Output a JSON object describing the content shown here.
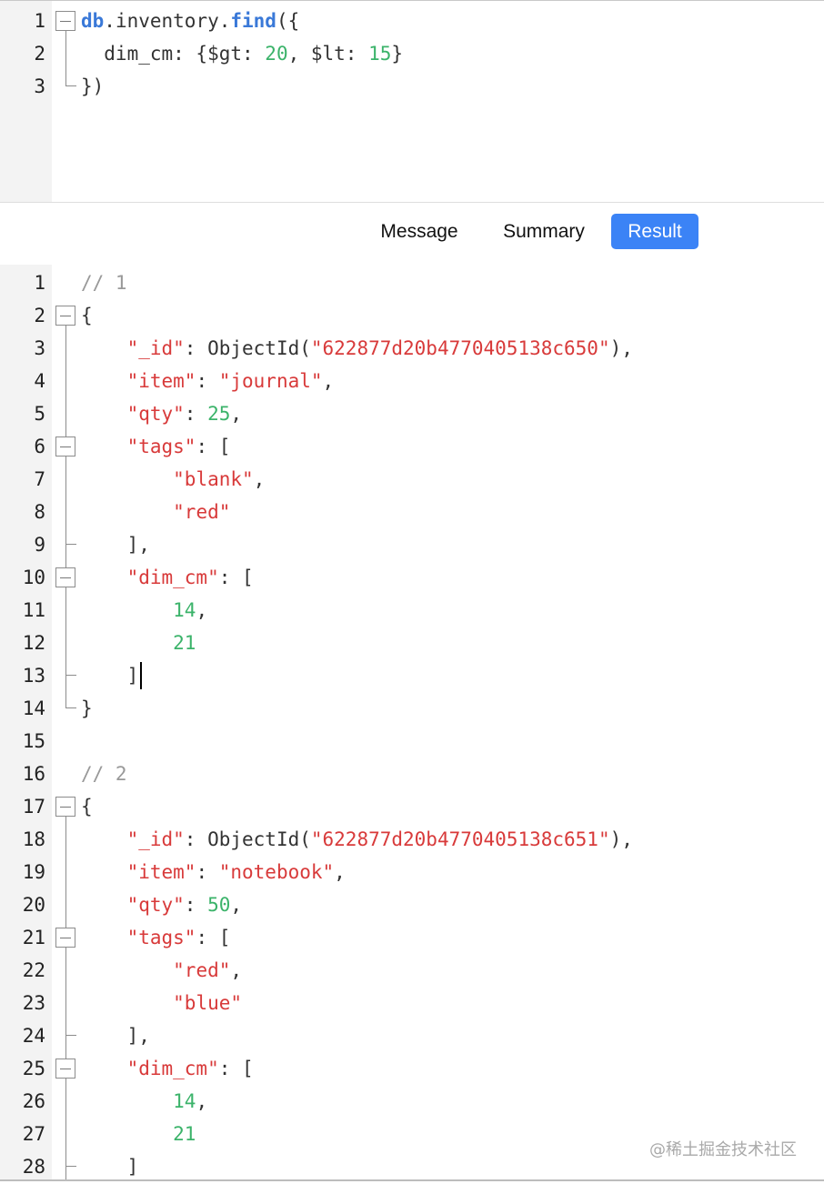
{
  "query": {
    "lines": [
      {
        "num": "1",
        "tokens": [
          [
            "kw",
            "db"
          ],
          [
            "pl",
            ".inventory."
          ],
          [
            "kw",
            "find"
          ],
          [
            "pl",
            "({"
          ]
        ]
      },
      {
        "num": "2",
        "tokens": [
          [
            "pl",
            "  dim_cm: {$gt: "
          ],
          [
            "num",
            "20"
          ],
          [
            "pl",
            ", $lt: "
          ],
          [
            "num",
            "15"
          ],
          [
            "pl",
            "}"
          ]
        ]
      },
      {
        "num": "3",
        "tokens": [
          [
            "pl",
            "})"
          ]
        ]
      }
    ]
  },
  "tabs": [
    {
      "label": "Message",
      "active": false
    },
    {
      "label": "Summary",
      "active": false
    },
    {
      "label": "Result",
      "active": true
    }
  ],
  "result": {
    "lines": [
      {
        "num": "1",
        "tokens": [
          [
            "com",
            "// 1"
          ]
        ]
      },
      {
        "num": "2",
        "tokens": [
          [
            "pl",
            "{"
          ]
        ]
      },
      {
        "num": "3",
        "tokens": [
          [
            "pl",
            "    "
          ],
          [
            "key",
            "\"_id\""
          ],
          [
            "pl",
            ": ObjectId("
          ],
          [
            "str",
            "\"622877d20b4770405138c650\""
          ],
          [
            "pl",
            "),"
          ]
        ]
      },
      {
        "num": "4",
        "tokens": [
          [
            "pl",
            "    "
          ],
          [
            "key",
            "\"item\""
          ],
          [
            "pl",
            ": "
          ],
          [
            "str",
            "\"journal\""
          ],
          [
            "pl",
            ","
          ]
        ]
      },
      {
        "num": "5",
        "tokens": [
          [
            "pl",
            "    "
          ],
          [
            "key",
            "\"qty\""
          ],
          [
            "pl",
            ": "
          ],
          [
            "num",
            "25"
          ],
          [
            "pl",
            ","
          ]
        ]
      },
      {
        "num": "6",
        "tokens": [
          [
            "pl",
            "    "
          ],
          [
            "key",
            "\"tags\""
          ],
          [
            "pl",
            ": ["
          ]
        ]
      },
      {
        "num": "7",
        "tokens": [
          [
            "pl",
            "        "
          ],
          [
            "str",
            "\"blank\""
          ],
          [
            "pl",
            ","
          ]
        ]
      },
      {
        "num": "8",
        "tokens": [
          [
            "pl",
            "        "
          ],
          [
            "str",
            "\"red\""
          ]
        ]
      },
      {
        "num": "9",
        "tokens": [
          [
            "pl",
            "    ],"
          ]
        ]
      },
      {
        "num": "10",
        "tokens": [
          [
            "pl",
            "    "
          ],
          [
            "key",
            "\"dim_cm\""
          ],
          [
            "pl",
            ": ["
          ]
        ]
      },
      {
        "num": "11",
        "tokens": [
          [
            "pl",
            "        "
          ],
          [
            "num",
            "14"
          ],
          [
            "pl",
            ","
          ]
        ]
      },
      {
        "num": "12",
        "tokens": [
          [
            "pl",
            "        "
          ],
          [
            "num",
            "21"
          ]
        ]
      },
      {
        "num": "13",
        "tokens": [
          [
            "pl",
            "    ]"
          ]
        ]
      },
      {
        "num": "14",
        "tokens": [
          [
            "pl",
            "}"
          ]
        ]
      },
      {
        "num": "15",
        "tokens": []
      },
      {
        "num": "16",
        "tokens": [
          [
            "com",
            "// 2"
          ]
        ]
      },
      {
        "num": "17",
        "tokens": [
          [
            "pl",
            "{"
          ]
        ]
      },
      {
        "num": "18",
        "tokens": [
          [
            "pl",
            "    "
          ],
          [
            "key",
            "\"_id\""
          ],
          [
            "pl",
            ": ObjectId("
          ],
          [
            "str",
            "\"622877d20b4770405138c651\""
          ],
          [
            "pl",
            "),"
          ]
        ]
      },
      {
        "num": "19",
        "tokens": [
          [
            "pl",
            "    "
          ],
          [
            "key",
            "\"item\""
          ],
          [
            "pl",
            ": "
          ],
          [
            "str",
            "\"notebook\""
          ],
          [
            "pl",
            ","
          ]
        ]
      },
      {
        "num": "20",
        "tokens": [
          [
            "pl",
            "    "
          ],
          [
            "key",
            "\"qty\""
          ],
          [
            "pl",
            ": "
          ],
          [
            "num",
            "50"
          ],
          [
            "pl",
            ","
          ]
        ]
      },
      {
        "num": "21",
        "tokens": [
          [
            "pl",
            "    "
          ],
          [
            "key",
            "\"tags\""
          ],
          [
            "pl",
            ": ["
          ]
        ]
      },
      {
        "num": "22",
        "tokens": [
          [
            "pl",
            "        "
          ],
          [
            "str",
            "\"red\""
          ],
          [
            "pl",
            ","
          ]
        ]
      },
      {
        "num": "23",
        "tokens": [
          [
            "pl",
            "        "
          ],
          [
            "str",
            "\"blue\""
          ]
        ]
      },
      {
        "num": "24",
        "tokens": [
          [
            "pl",
            "    ],"
          ]
        ]
      },
      {
        "num": "25",
        "tokens": [
          [
            "pl",
            "    "
          ],
          [
            "key",
            "\"dim_cm\""
          ],
          [
            "pl",
            ": ["
          ]
        ]
      },
      {
        "num": "26",
        "tokens": [
          [
            "pl",
            "        "
          ],
          [
            "num",
            "14"
          ],
          [
            "pl",
            ","
          ]
        ]
      },
      {
        "num": "27",
        "tokens": [
          [
            "pl",
            "        "
          ],
          [
            "num",
            "21"
          ]
        ]
      },
      {
        "num": "28",
        "tokens": [
          [
            "pl",
            "    ]"
          ]
        ]
      }
    ]
  },
  "watermark": "@稀土掘金技术社区",
  "colors": {
    "accent": "#3b83f6",
    "string": "#d83a3a",
    "number": "#3bb36a",
    "keyword": "#3a79d8",
    "comment": "#999999"
  }
}
